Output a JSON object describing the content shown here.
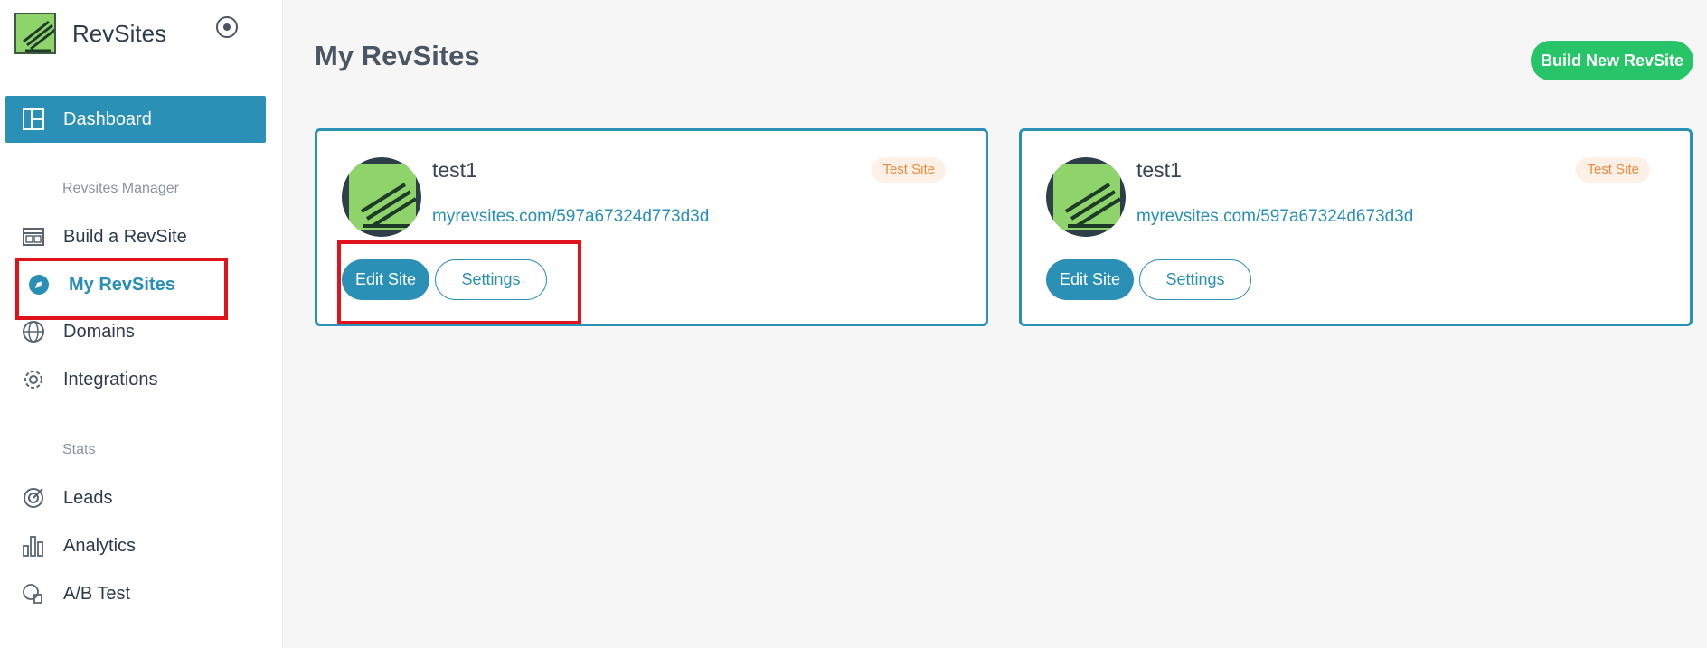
{
  "app": {
    "name": "RevSites"
  },
  "sidebar": {
    "dashboard": "Dashboard",
    "section_manager": "Revsites Manager",
    "build": "Build a RevSite",
    "my_revsites": "My RevSites",
    "domains": "Domains",
    "integrations": "Integrations",
    "section_stats": "Stats",
    "leads": "Leads",
    "analytics": "Analytics",
    "ab_test": "A/B Test"
  },
  "main": {
    "title": "My RevSites",
    "build_button": "Build New RevSite",
    "sites": [
      {
        "name": "test1",
        "badge": "Test Site",
        "url": "myrevsites.com/597a67324d773d3d",
        "edit_label": "Edit Site",
        "settings_label": "Settings"
      },
      {
        "name": "test1",
        "badge": "Test Site",
        "url": "myrevsites.com/597a67324d673d3d",
        "edit_label": "Edit Site",
        "settings_label": "Settings"
      }
    ]
  },
  "colors": {
    "accent": "#2a90b5",
    "build_button": "#27c46a",
    "badge_text": "#f28a3b",
    "highlight": "#e0121b"
  }
}
